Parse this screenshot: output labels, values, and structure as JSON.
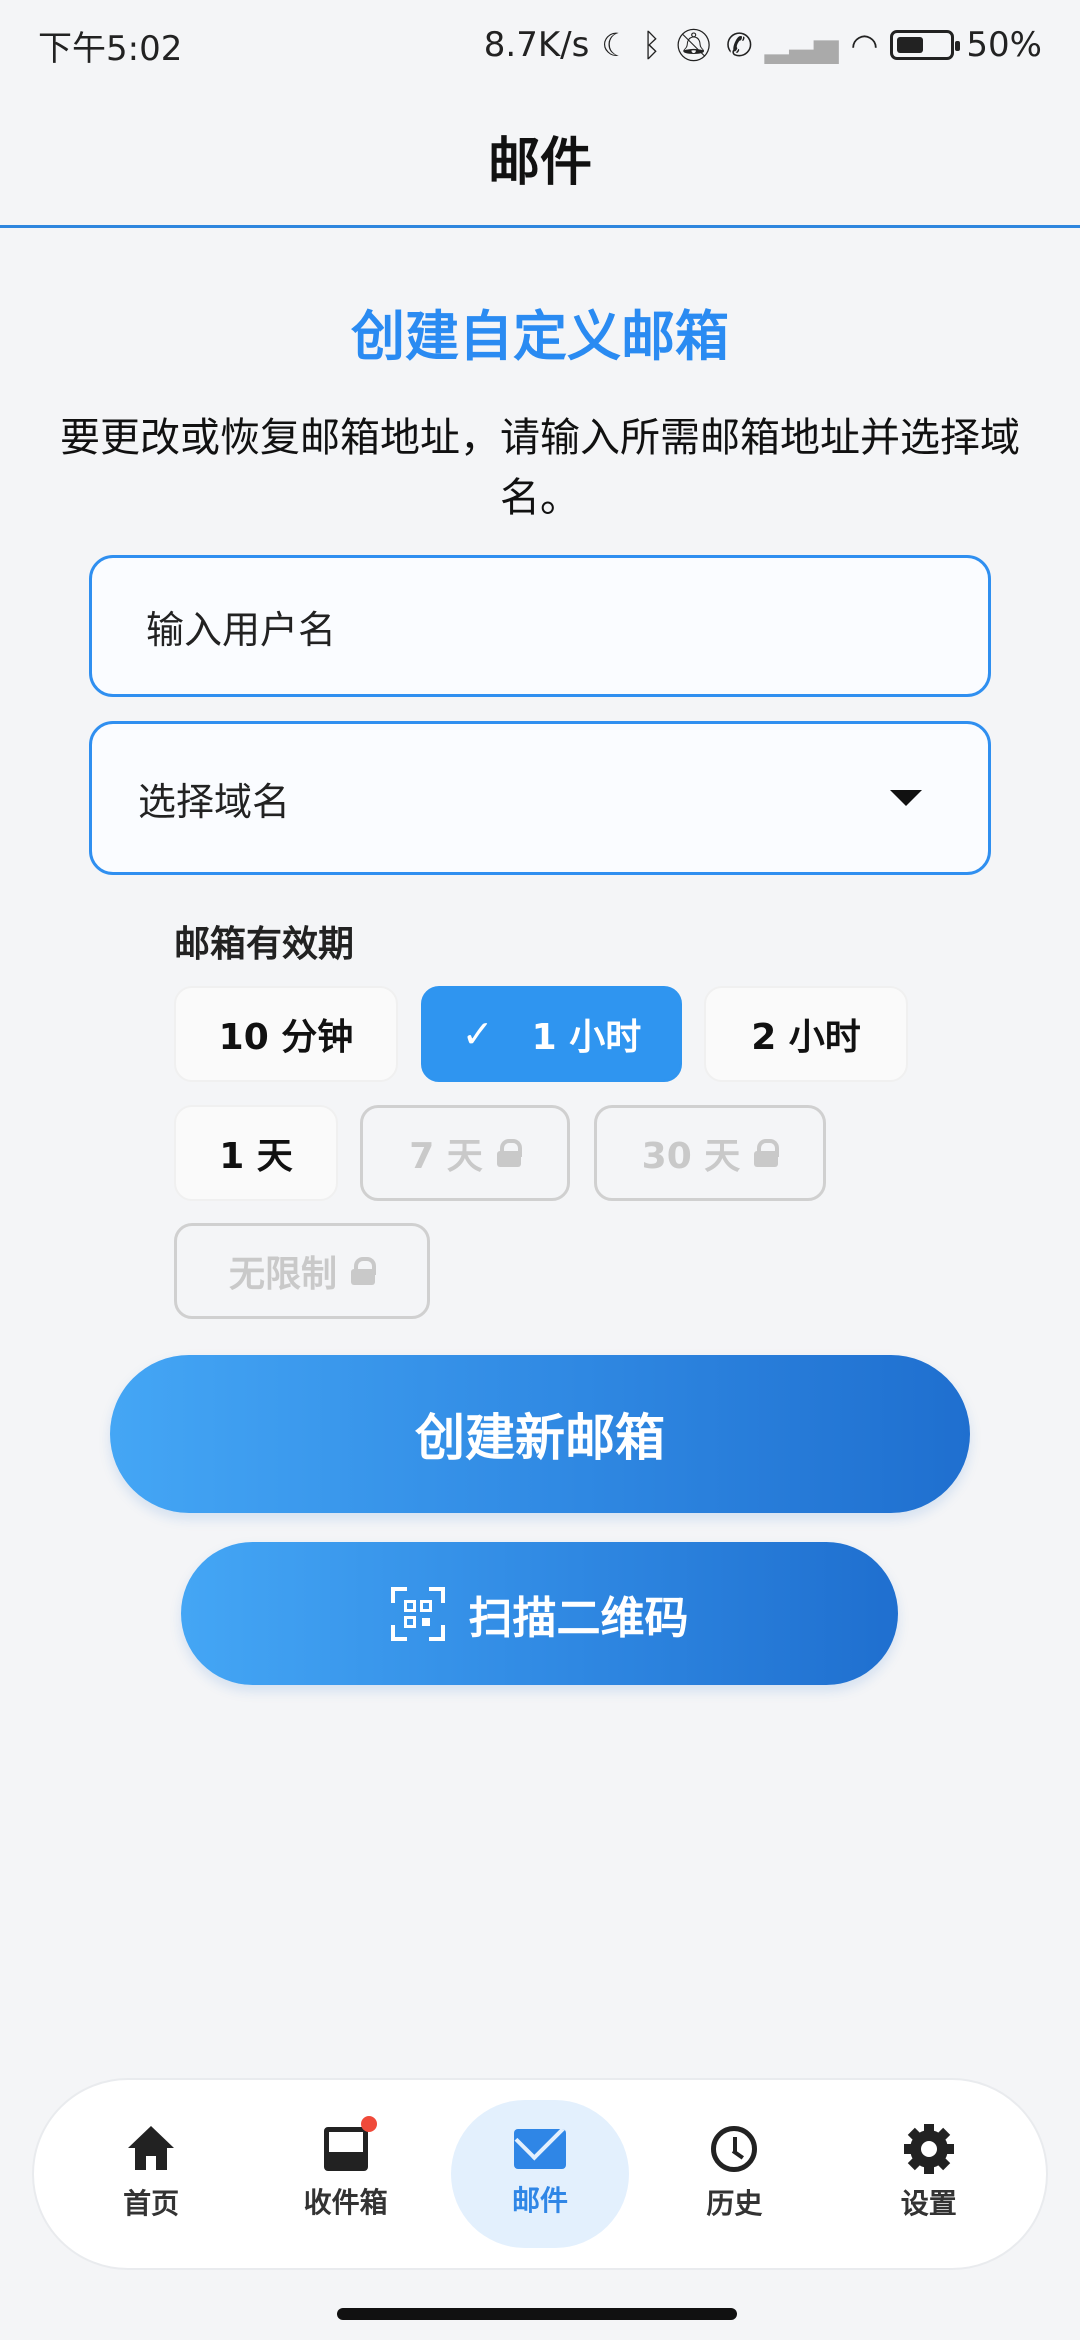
{
  "status_bar": {
    "time": "下午5:02",
    "network_speed": "8.7K/s",
    "icons": [
      "moon-icon",
      "bluetooth-icon",
      "mute-icon",
      "call-icon",
      "signal-icon",
      "wifi-icon",
      "battery-icon"
    ],
    "battery_percent": "50%",
    "battery_level": 0.5
  },
  "header": {
    "title": "邮件"
  },
  "main": {
    "heading": "创建自定义邮箱",
    "description": "要更改或恢复邮箱地址，请输入所需邮箱地址并选择域名。",
    "username_placeholder": "输入用户名",
    "domain_placeholder": "选择域名",
    "expiry": {
      "label": "邮箱有效期",
      "options": [
        {
          "label": "10 分钟",
          "selected": false,
          "locked": false
        },
        {
          "label": "1 小时",
          "selected": true,
          "locked": false
        },
        {
          "label": "2 小时",
          "selected": false,
          "locked": false
        },
        {
          "label": "1 天",
          "selected": false,
          "locked": false
        },
        {
          "label": "7 天",
          "selected": false,
          "locked": true
        },
        {
          "label": "30 天",
          "selected": false,
          "locked": true
        },
        {
          "label": "无限制",
          "selected": false,
          "locked": true
        }
      ]
    },
    "create_button": "创建新邮箱",
    "scan_button": "扫描二维码"
  },
  "bottom_nav": {
    "items": [
      {
        "label": "首页",
        "icon": "home-icon",
        "active": false
      },
      {
        "label": "收件箱",
        "icon": "inbox-icon",
        "active": false,
        "has_notification": true
      },
      {
        "label": "邮件",
        "icon": "mail-icon",
        "active": true
      },
      {
        "label": "历史",
        "icon": "history-icon",
        "active": false
      },
      {
        "label": "设置",
        "icon": "gear-icon",
        "active": false
      }
    ]
  },
  "colors": {
    "accent": "#2a8bf2",
    "selected_chip": "#2f95f0",
    "nav_active_bg": "#e3f0fd",
    "notification_dot": "#f04a3a"
  }
}
